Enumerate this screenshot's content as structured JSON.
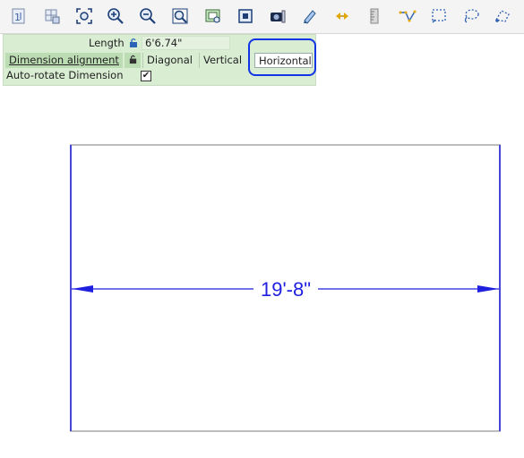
{
  "toolbar": {
    "buttons": [
      "page-number-icon",
      "grid-select-icon",
      "zoom-extents-icon",
      "zoom-in-icon",
      "zoom-out-icon",
      "zoom-window-icon",
      "fit-page-icon",
      "zoom-select-icon",
      "camera-icon",
      "pencil-icon",
      "align-arrows-icon",
      "ruler-icon",
      "polyline-icon",
      "selection-box-icon",
      "lasso-icon"
    ]
  },
  "properties": {
    "length_label": "Length",
    "length_value": "6'6.74\"",
    "alignment_label": "Dimension alignment",
    "options": [
      "Diagonal",
      "Vertical",
      "Horizontal"
    ],
    "selected": "Horizontal",
    "auto_rotate_label": "Auto-rotate Dimension",
    "auto_rotate_checked": true
  },
  "drawing": {
    "dimension_text": "19'-8\"",
    "dimension_color": "#1f1fe0"
  }
}
